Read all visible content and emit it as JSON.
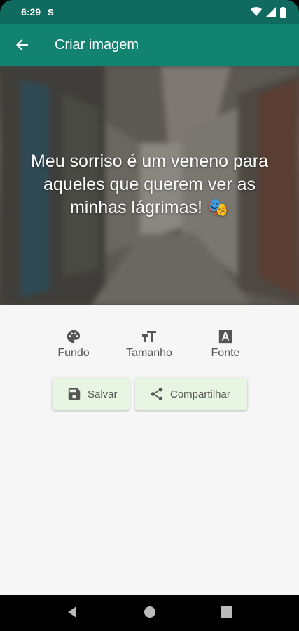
{
  "status": {
    "time": "6:29",
    "sim_label": "S"
  },
  "appbar": {
    "title": "Criar imagem"
  },
  "quote": {
    "text": "Meu sorriso é um veneno para aqueles que querem ver as minhas lágrimas! 🎭"
  },
  "tools": [
    {
      "label": "Fundo",
      "icon": "palette-icon"
    },
    {
      "label": "Tamanho",
      "icon": "text-size-icon"
    },
    {
      "label": "Fonte",
      "icon": "font-icon"
    }
  ],
  "actions": {
    "save_label": "Salvar",
    "share_label": "Compartilhar"
  },
  "colors": {
    "status_bar": "#0f6b5f",
    "app_bar": "#128271",
    "button_bg": "#e8f5e2"
  }
}
